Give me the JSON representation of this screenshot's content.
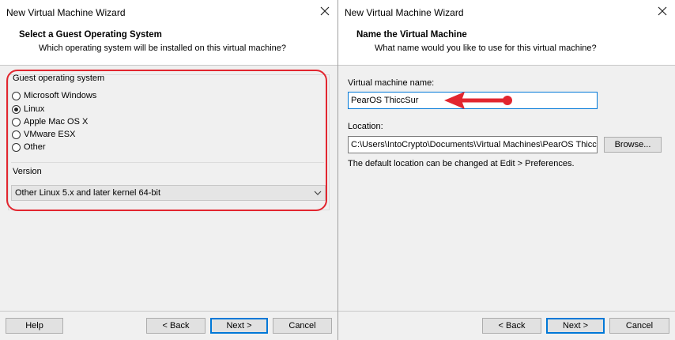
{
  "left": {
    "window_title": "New Virtual Machine Wizard",
    "header_title": "Select a Guest Operating System",
    "header_subtitle": "Which operating system will be installed on this virtual machine?",
    "group_label": "Guest operating system",
    "os_options": [
      {
        "label": "Microsoft Windows",
        "selected": false
      },
      {
        "label": "Linux",
        "selected": true
      },
      {
        "label": "Apple Mac OS X",
        "selected": false
      },
      {
        "label": "VMware ESX",
        "selected": false
      },
      {
        "label": "Other",
        "selected": false
      }
    ],
    "version_label": "Version",
    "version_value": "Other Linux 5.x and later kernel 64-bit",
    "buttons": {
      "help": "Help",
      "back": "< Back",
      "next": "Next >",
      "cancel": "Cancel"
    }
  },
  "right": {
    "window_title": "New Virtual Machine Wizard",
    "header_title": "Name the Virtual Machine",
    "header_subtitle": "What name would you like to use for this virtual machine?",
    "name_label": "Virtual machine name:",
    "name_value": "PearOS ThiccSur",
    "location_label": "Location:",
    "location_value": "C:\\Users\\IntoCrypto\\Documents\\Virtual Machines\\PearOS ThiccS",
    "browse_label": "Browse...",
    "location_hint": "The default location can be changed at Edit > Preferences.",
    "buttons": {
      "back": "< Back",
      "next": "Next >",
      "cancel": "Cancel"
    }
  },
  "colors": {
    "highlight": "#e2262f",
    "focus": "#0078d7",
    "panel_bg": "#f0f0f0"
  },
  "icons": {
    "close": "close-icon",
    "dropdown": "chevron-down-icon",
    "annotation": "red-arrow-icon"
  }
}
